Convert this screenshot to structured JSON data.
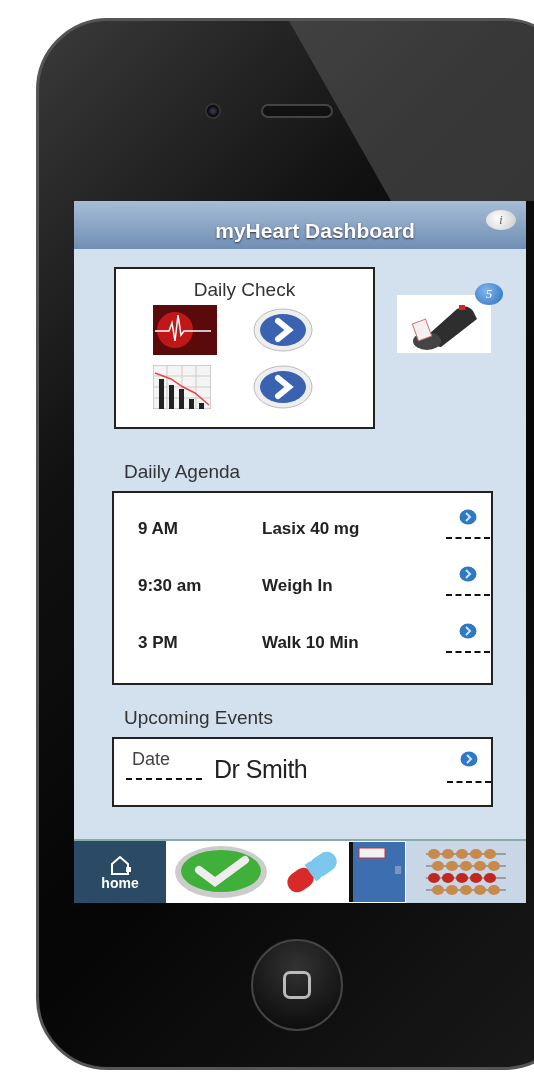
{
  "header": {
    "title": "myHeart Dashboard",
    "info_button": "i"
  },
  "daily_check": {
    "title": "Daily Check",
    "items": [
      {
        "kind": "ecg"
      },
      {
        "kind": "chart"
      }
    ]
  },
  "messages": {
    "badge": "5"
  },
  "agenda": {
    "title": "Daiily Agenda",
    "items": [
      {
        "time": "9 AM",
        "task": "Lasix 40 mg"
      },
      {
        "time": "9:30 am",
        "task": "Weigh In"
      },
      {
        "time": "3 PM",
        "task": "Walk 10 Min"
      }
    ]
  },
  "events": {
    "title": "Upcoming Events",
    "items": [
      {
        "date": "Date",
        "name": "Dr Smith"
      }
    ]
  },
  "tab_bar": {
    "items": [
      {
        "kind": "home",
        "label": "home",
        "selected": true
      },
      {
        "kind": "check",
        "selected": false
      },
      {
        "kind": "pill",
        "selected": false
      },
      {
        "kind": "journal",
        "selected": false
      },
      {
        "kind": "abacus",
        "selected": false
      }
    ]
  }
}
